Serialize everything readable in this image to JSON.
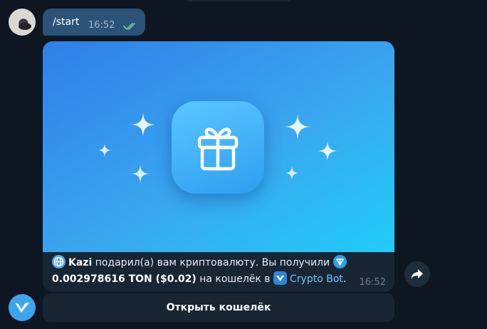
{
  "outgoing": {
    "command": "/start",
    "time": "16:52",
    "status": "read"
  },
  "gift_card": {
    "caption": {
      "sender": "Kazi",
      "text_1": "подарил(а) вам криптовалюту. Вы получили",
      "amount": "0.002978616 TON ($0.02)",
      "text_2": "на кошелёк в",
      "bot_link": "Crypto Bot",
      "end": "."
    },
    "time": "16:52",
    "open_wallet_label": "Открыть кошелёк"
  },
  "colors": {
    "background": "#0e1621",
    "outgoing_bubble": "#2b5278",
    "incoming_bubble": "#182533",
    "link": "#6ec8ff",
    "hero_start": "#2f7fe8",
    "hero_end": "#21cdf8"
  },
  "icons": {
    "user_avatar": "user-avatar",
    "read_ticks": "double-check-icon",
    "gift": "gift-icon",
    "sparkles": "sparkle-icon",
    "globe": "globe-icon",
    "ton": "ton-icon",
    "cryptobot": "cryptobot-icon",
    "share": "share-icon",
    "bot_avatar": "cryptobot-avatar"
  }
}
